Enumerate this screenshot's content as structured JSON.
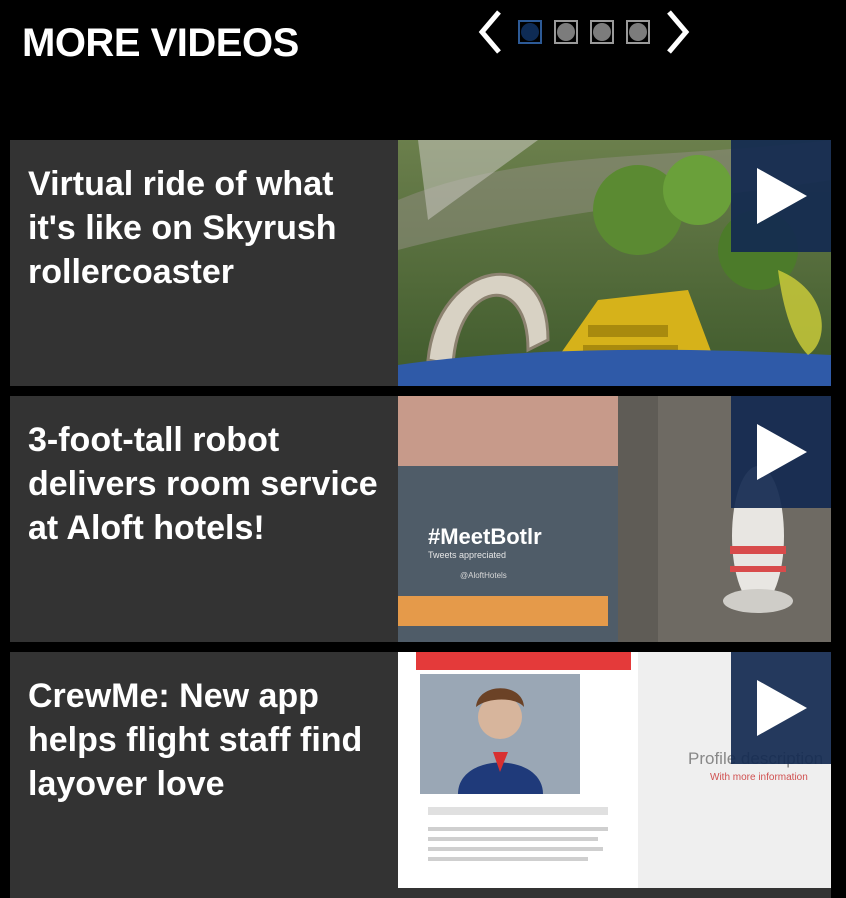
{
  "header": {
    "title": "MORE VIDEOS",
    "pager": {
      "page_count": 4,
      "active_page": 1,
      "prev_icon": "chevron-left-icon",
      "next_icon": "chevron-right-icon"
    }
  },
  "videos": [
    {
      "title": "Virtual ride of what it's like on Skyrush rollercoaster",
      "icon": "play-icon"
    },
    {
      "title": "3-foot-tall robot delivers room service at Aloft hotels!",
      "icon": "play-icon",
      "thumbnail_text": {
        "hashtag": "#MeetBotlr",
        "tagline": "Tweets appreciated",
        "handle": "@AloftHotels"
      }
    },
    {
      "title": "CrewMe: New app helps flight staff find layover love",
      "icon": "play-icon",
      "thumbnail_text": {
        "profile_heading": "Profile description",
        "profile_sub": "With more information"
      }
    }
  ],
  "colors": {
    "background": "#000000",
    "card": "#333333",
    "play_box": "#122950",
    "active_dot": "#0e2b55"
  }
}
